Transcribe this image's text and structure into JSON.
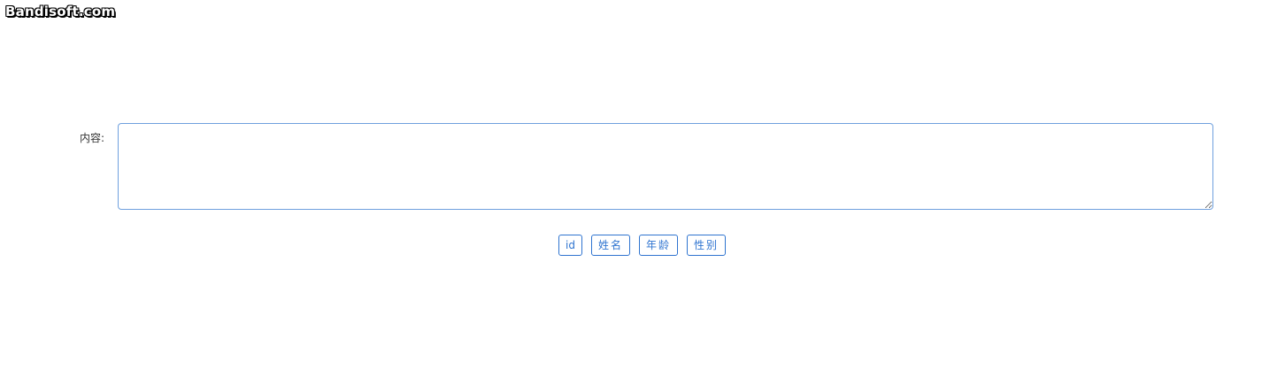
{
  "watermark": {
    "text": "Bandisoft.com"
  },
  "form": {
    "content_label": "内容:",
    "content_value": "",
    "content_placeholder": ""
  },
  "buttons": [
    {
      "label": "id"
    },
    {
      "label": "姓名"
    },
    {
      "label": "年龄"
    },
    {
      "label": "性别"
    }
  ],
  "colors": {
    "accent": "#2f74d0",
    "textarea_border": "#6fa0de",
    "label_text": "#333333"
  }
}
